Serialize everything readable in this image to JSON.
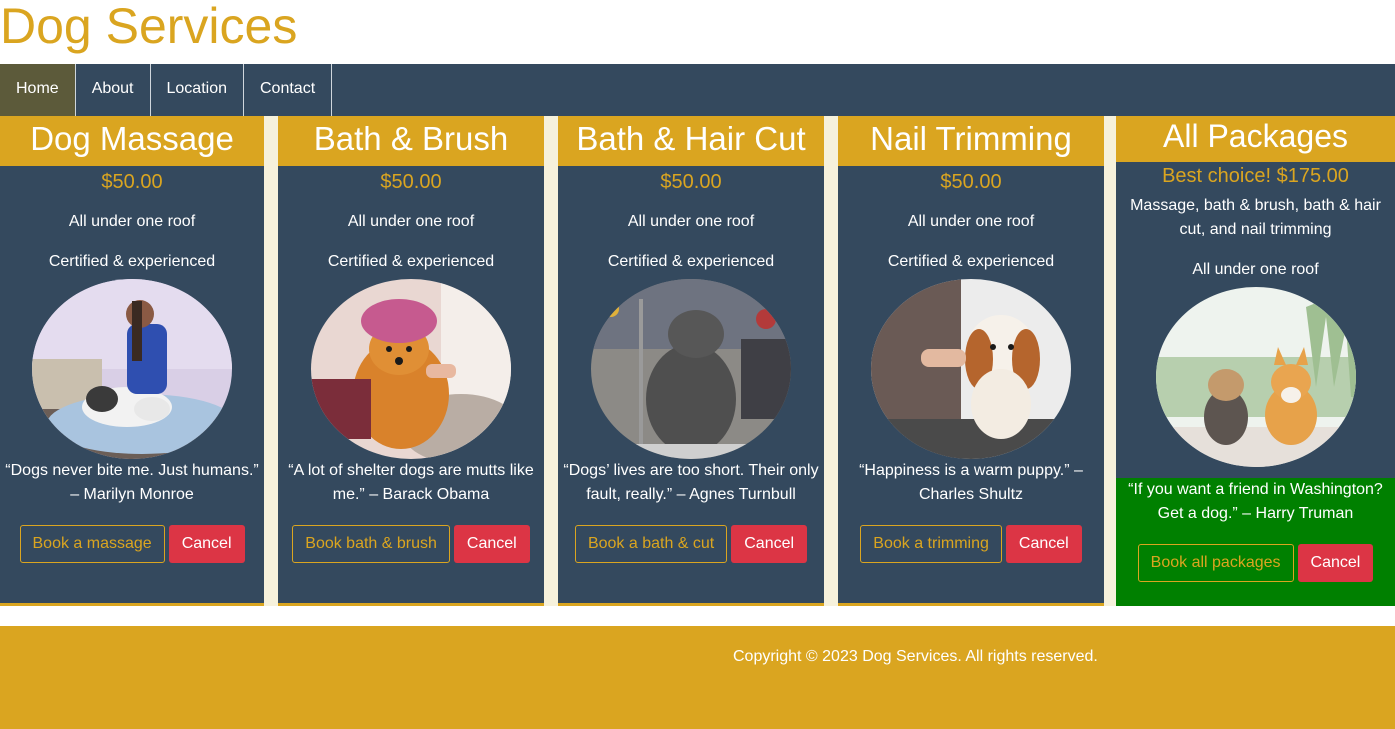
{
  "site": {
    "title": "Dog Services"
  },
  "nav": [
    {
      "label": "Home"
    },
    {
      "label": "About"
    },
    {
      "label": "Location"
    },
    {
      "label": "Contact"
    }
  ],
  "cards": [
    {
      "title": "Dog Massage",
      "price": "$50.00",
      "feature1": "All under one roof",
      "feature2": "Certified & experienced",
      "quote": "“Dogs never bite me. Just humans.” – Marilyn Monroe",
      "book_label": "Book a massage",
      "cancel_label": "Cancel"
    },
    {
      "title": "Bath & Brush",
      "price": "$50.00",
      "feature1": "All under one roof",
      "feature2": "Certified & experienced",
      "quote": "“A lot of shelter dogs are mutts like me.” – Barack Obama",
      "book_label": "Book bath & brush",
      "cancel_label": "Cancel"
    },
    {
      "title": "Bath & Hair Cut",
      "price": "$50.00",
      "feature1": "All under one roof",
      "feature2": "Certified & experienced",
      "quote": "“Dogs’ lives are too short. Their only fault, really.” – Agnes Turnbull",
      "book_label": "Book a bath & cut",
      "cancel_label": "Cancel"
    },
    {
      "title": "Nail Trimming",
      "price": "$50.00",
      "feature1": "All under one roof",
      "feature2": "Certified & experienced",
      "quote": "“Happiness is a warm puppy.” – Charles Shultz",
      "book_label": "Book a trimming",
      "cancel_label": "Cancel"
    },
    {
      "title": "All Packages",
      "price": "Best choice! $175.00",
      "description": "Massage, bath & brush, bath & hair cut, and nail trimming",
      "feature1": "All under one roof",
      "quote": "“If you want a friend in Washington? Get a dog.” – Harry Truman",
      "book_label": "Book all packages",
      "cancel_label": "Cancel"
    }
  ],
  "footer": {
    "copyright": "Copyright © 2023 Dog Services. All rights reserved."
  },
  "colors": {
    "accent": "#DAA520",
    "panel": "#34495E",
    "cancel": "#dc3545",
    "highlight": "#008000"
  }
}
